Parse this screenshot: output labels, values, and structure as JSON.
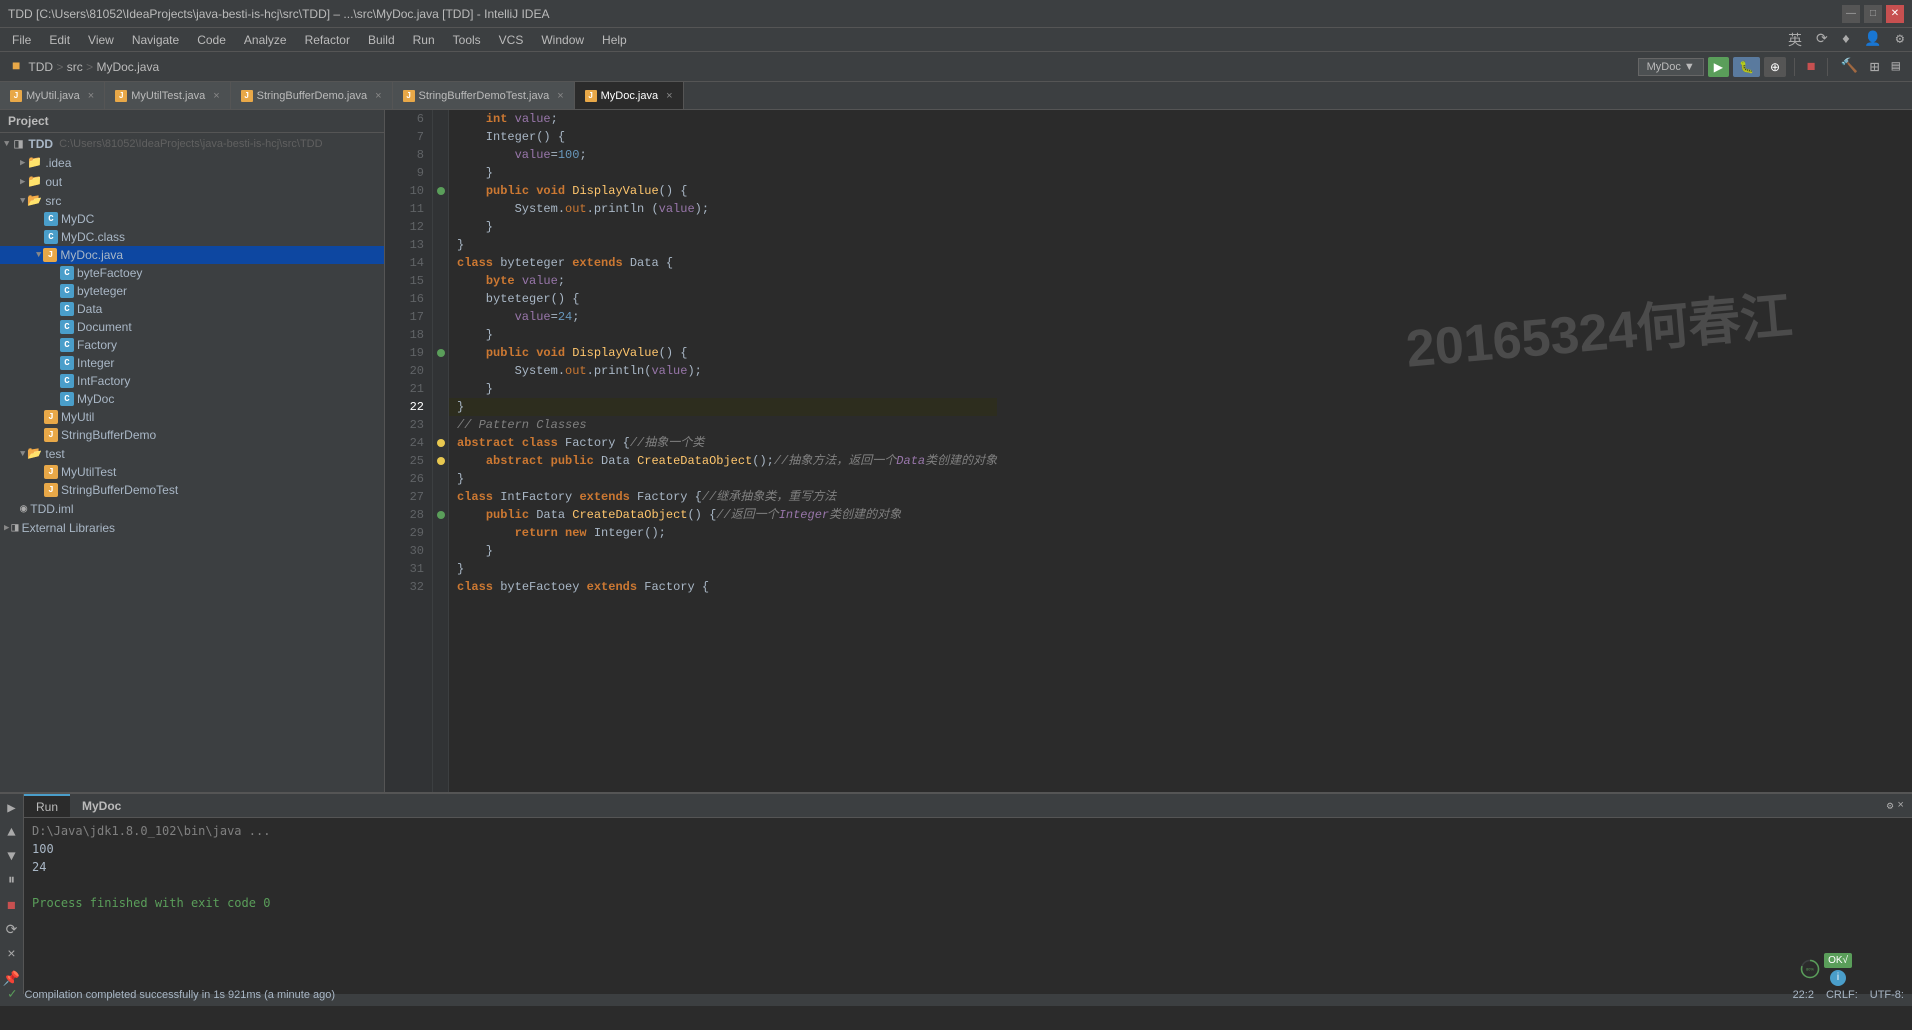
{
  "titleBar": {
    "text": "TDD [C:\\Users\\81052\\IdeaProjects\\java-besti-is-hcj\\src\\TDD] – ...\\src\\MyDoc.java [TDD] - IntelliJ IDEA",
    "minBtn": "—",
    "maxBtn": "□",
    "closeBtn": "✕"
  },
  "menuBar": {
    "items": [
      "File",
      "Edit",
      "View",
      "Navigate",
      "Code",
      "Analyze",
      "Refactor",
      "Build",
      "Run",
      "Tools",
      "VCS",
      "Window",
      "Help"
    ],
    "rightIcons": [
      "英",
      "⟳",
      "♦",
      "👤",
      "⚙"
    ]
  },
  "toolbar": {
    "breadcrumb": "TDD > src > MyDoc.java",
    "projectLabel": "MyDoc",
    "projectDropdown": "▼"
  },
  "fileTabs": [
    {
      "name": "MyUtil.java",
      "type": "orange",
      "active": false
    },
    {
      "name": "MyUtilTest.java",
      "type": "orange",
      "active": false
    },
    {
      "name": "StringBufferDemo.java",
      "type": "orange",
      "active": false
    },
    {
      "name": "StringBufferDemoTest.java",
      "type": "orange",
      "active": false
    },
    {
      "name": "MyDoc.java",
      "type": "orange",
      "active": true
    }
  ],
  "sidebar": {
    "header": "Project",
    "items": [
      {
        "label": "TDD",
        "level": 0,
        "type": "module",
        "expanded": true,
        "path": "C:\\Users\\81052\\IdeaProjects\\java-besti-is-hcj\\src\\TDD"
      },
      {
        "label": ".idea",
        "level": 1,
        "type": "folder",
        "expanded": false
      },
      {
        "label": "out",
        "level": 1,
        "type": "folder",
        "expanded": false
      },
      {
        "label": "src",
        "level": 1,
        "type": "folder",
        "expanded": true
      },
      {
        "label": "MyDC",
        "level": 2,
        "type": "class-blue"
      },
      {
        "label": "MyDC.class",
        "level": 2,
        "type": "class-blue"
      },
      {
        "label": "MyDoc.java",
        "level": 2,
        "type": "java-orange",
        "selected": true,
        "expanded": true
      },
      {
        "label": "byteFactoey",
        "level": 3,
        "type": "class-blue"
      },
      {
        "label": "byteteger",
        "level": 3,
        "type": "class-blue"
      },
      {
        "label": "Data",
        "level": 3,
        "type": "class-blue"
      },
      {
        "label": "Document",
        "level": 3,
        "type": "class-blue"
      },
      {
        "label": "Factory",
        "level": 3,
        "type": "class-blue"
      },
      {
        "label": "Integer",
        "level": 3,
        "type": "class-blue"
      },
      {
        "label": "IntFactory",
        "level": 3,
        "type": "class-blue"
      },
      {
        "label": "MyDoc",
        "level": 3,
        "type": "class-blue"
      },
      {
        "label": "MyUtil",
        "level": 2,
        "type": "java-orange"
      },
      {
        "label": "StringBufferDemo",
        "level": 2,
        "type": "java-orange"
      },
      {
        "label": "test",
        "level": 1,
        "type": "folder",
        "expanded": true
      },
      {
        "label": "MyUtilTest",
        "level": 2,
        "type": "java-orange"
      },
      {
        "label": "StringBufferDemoTest",
        "level": 2,
        "type": "java-orange"
      },
      {
        "label": "TDD.iml",
        "level": 1,
        "type": "module"
      },
      {
        "label": "External Libraries",
        "level": 0,
        "type": "folder",
        "expanded": false
      }
    ]
  },
  "codeLines": [
    {
      "num": 6,
      "content": "    int value;",
      "gutter": ""
    },
    {
      "num": 7,
      "content": "    Integer() {",
      "gutter": ""
    },
    {
      "num": 8,
      "content": "        value=100;",
      "gutter": ""
    },
    {
      "num": 9,
      "content": "    }",
      "gutter": ""
    },
    {
      "num": 10,
      "content": "    public void DisplayValue() {",
      "gutter": "green"
    },
    {
      "num": 11,
      "content": "        System.out.println (value);",
      "gutter": ""
    },
    {
      "num": 12,
      "content": "    }",
      "gutter": ""
    },
    {
      "num": 13,
      "content": "}",
      "gutter": ""
    },
    {
      "num": 14,
      "content": "class byteteger extends Data {",
      "gutter": ""
    },
    {
      "num": 15,
      "content": "    byte value;",
      "gutter": ""
    },
    {
      "num": 16,
      "content": "    byteteger() {",
      "gutter": ""
    },
    {
      "num": 17,
      "content": "        value=24;",
      "gutter": ""
    },
    {
      "num": 18,
      "content": "    }",
      "gutter": ""
    },
    {
      "num": 19,
      "content": "    public void DisplayValue() {",
      "gutter": "green"
    },
    {
      "num": 20,
      "content": "        System.out.println(value);",
      "gutter": ""
    },
    {
      "num": 21,
      "content": "    }",
      "gutter": ""
    },
    {
      "num": 22,
      "content": "}",
      "gutter": "",
      "current": true
    },
    {
      "num": 23,
      "content": "// Pattern Classes",
      "gutter": ""
    },
    {
      "num": 24,
      "content": "abstract class Factory {//抽象一个类",
      "gutter": "yellow"
    },
    {
      "num": 25,
      "content": "    abstract public Data CreateDataObject();//抽象方法，返回一个Data类创建的对象",
      "gutter": "yellow"
    },
    {
      "num": 26,
      "content": "}",
      "gutter": ""
    },
    {
      "num": 27,
      "content": "class IntFactory extends Factory {//继承抽象类，重写方法",
      "gutter": ""
    },
    {
      "num": 28,
      "content": "    public Data CreateDataObject() {//返回一个Integer类创建的对象",
      "gutter": "green"
    },
    {
      "num": 29,
      "content": "        return new Integer();",
      "gutter": ""
    },
    {
      "num": 30,
      "content": "    }",
      "gutter": ""
    },
    {
      "num": 31,
      "content": "}",
      "gutter": ""
    },
    {
      "num": 32,
      "content": "class byteFactoey extends Factory {",
      "gutter": ""
    }
  ],
  "watermark": "20165324何春江",
  "bottomPanel": {
    "tabs": [
      "Run",
      "MyDoc"
    ],
    "activeTab": "MyDoc",
    "runLines": [
      {
        "text": "D:\\Java\\jdk1.8.0_102\\bin\\java ...",
        "type": "cmd"
      },
      {
        "text": "100",
        "type": "output"
      },
      {
        "text": "24",
        "type": "output"
      },
      {
        "text": "",
        "type": "output"
      },
      {
        "text": "Process finished with exit code 0",
        "type": "success"
      }
    ]
  },
  "statusBar": {
    "message": "Compilation completed successfully in 1s 921ms (a minute ago)",
    "position": "22:2",
    "lineEnding": "CRLF:",
    "encoding": "UTF-8:",
    "iconColor": "#5a9e5a"
  },
  "progressCircle": {
    "percent": 80,
    "label": "80%",
    "okLabel": "OK√"
  },
  "icons": {
    "folderOpen": "📂",
    "folderClosed": "📁",
    "playIcon": "▶",
    "debugIcon": "🐛",
    "stopIcon": "◼",
    "buildIcon": "🔨"
  }
}
